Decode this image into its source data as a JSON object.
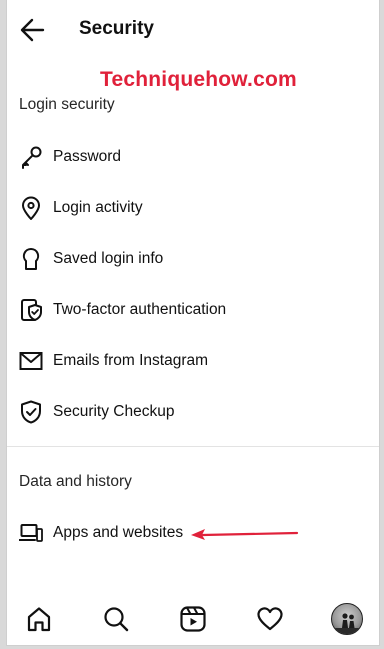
{
  "header": {
    "title": "Security"
  },
  "watermark": "Techniquehow.com",
  "sections": [
    {
      "label": "Login security",
      "items": [
        {
          "label": "Password",
          "icon": "key-icon"
        },
        {
          "label": "Login activity",
          "icon": "location-pin-icon"
        },
        {
          "label": "Saved login info",
          "icon": "keyhole-icon"
        },
        {
          "label": "Two-factor authentication",
          "icon": "shield-phone-icon"
        },
        {
          "label": "Emails from Instagram",
          "icon": "mail-icon"
        },
        {
          "label": "Security Checkup",
          "icon": "shield-check-icon"
        }
      ]
    },
    {
      "label": "Data and history",
      "items": [
        {
          "label": "Apps and websites",
          "icon": "devices-icon"
        }
      ]
    }
  ],
  "bottom_nav": [
    "home-icon",
    "search-icon",
    "reels-icon",
    "heart-icon",
    "profile-avatar"
  ],
  "colors": {
    "accent_red": "#e0213a",
    "text": "#111111",
    "section_text": "#262626"
  }
}
